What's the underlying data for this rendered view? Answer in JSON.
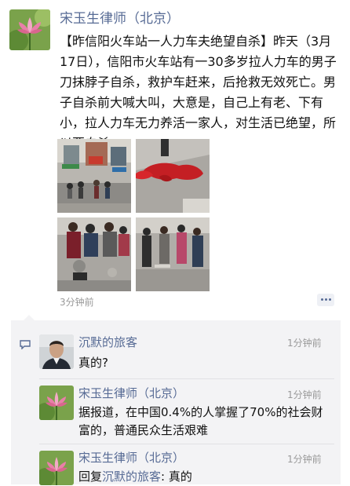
{
  "post": {
    "author": "宋玉生律师（北京）",
    "text": "【昨信阳火车站一人力车夫绝望自杀】昨天（3月17日），信阳市火车站有一30多岁拉人力车的男子刀抹脖子自杀，救护车赶来，后抢救无效死亡。男子自杀前大喊大叫，大意是，自己上有老、下有小，拉人力车无力养活一家人，对生活已绝望，所以要自杀。",
    "time": "3分钟前",
    "photos": [
      "street-scene-photo",
      "blood-on-ground-photo",
      "crowd-gathered-photo",
      "crowd-on-street-photo"
    ]
  },
  "comments": [
    {
      "author": "沉默的旅客",
      "time": "1分钟前",
      "text": "真的?"
    },
    {
      "author": "宋玉生律师（北京）",
      "time": "1分钟前",
      "text": "据报道，在中国0.4%的人掌握了70%的社会财富的，普通民众生活艰难"
    },
    {
      "author": "宋玉生律师（北京）",
      "time": "1分钟前",
      "reply_prefix": "回复",
      "reply_to": "沉默的旅客",
      "reply_text": ": 真的"
    }
  ],
  "colors": {
    "link": "#576b95",
    "comment_bg": "#f3f3f5",
    "muted": "#999999"
  }
}
